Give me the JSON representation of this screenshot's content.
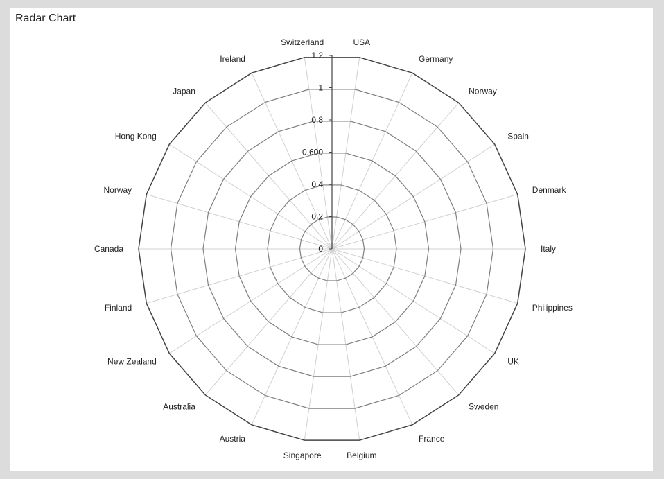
{
  "panel": {
    "title": "Radar Chart"
  },
  "chart_data": {
    "type": "radar",
    "title": "Radar Chart",
    "categories": [
      "USA",
      "Germany",
      "Norway",
      "Spain",
      "Denmark",
      "Italy",
      "Philippines",
      "UK",
      "Sweden",
      "France",
      "Belgium",
      "Singapore",
      "Austria",
      "Australia",
      "New Zealand",
      "Finland",
      "Canada",
      "Norway",
      "Hong Kong",
      "Japan",
      "Ireland",
      "Switzerland"
    ],
    "radial_ticks": [
      "0",
      "0.2",
      "0.4",
      "0.600",
      "0.8",
      "1",
      "1.2"
    ],
    "tick_values": [
      0,
      0.2,
      0.4,
      0.6,
      0.8,
      1.0,
      1.2
    ],
    "rlim": [
      0,
      1.2
    ],
    "series": [],
    "grid": true,
    "colors": {
      "grid_ring": "#7f7f7f",
      "outer_ring": "#444444",
      "spoke": "#d0d0d0",
      "axis": "#444444"
    }
  }
}
